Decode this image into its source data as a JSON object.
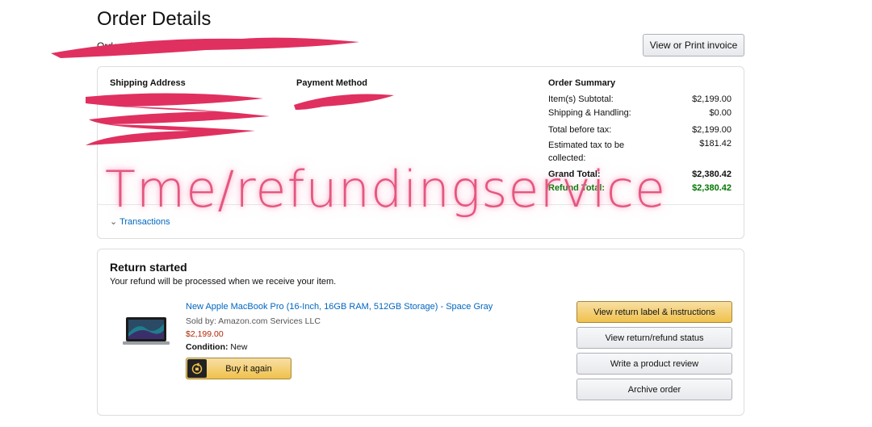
{
  "page": {
    "title": "Order Details",
    "ordered_line": "Ordered on",
    "invoice_button": "View or Print invoice"
  },
  "details": {
    "shipping_label": "Shipping Address",
    "payment_label": "Payment Method",
    "summary": {
      "heading": "Order Summary",
      "rows": [
        {
          "label": "Item(s) Subtotal:",
          "value": "$2,199.00"
        },
        {
          "label": "Shipping & Handling:",
          "value": "$0.00"
        },
        {
          "label": "Total before tax:",
          "value": "$2,199.00"
        },
        {
          "label": "Estimated tax to be collected:",
          "value": "$181.42"
        }
      ],
      "grand_total_label": "Grand Total:",
      "grand_total_value": "$2,380.42",
      "refund_total_label": "Refund Total:",
      "refund_total_value": "$2,380.42"
    },
    "transactions_link": "Transactions"
  },
  "return": {
    "title": "Return started",
    "subtitle": "Your refund will be processed when we receive your item.",
    "product": {
      "name": "New Apple MacBook Pro (16-Inch, 16GB RAM, 512GB Storage) - Space Gray",
      "sold_by": "Sold by: Amazon.com Services LLC",
      "price": "$2,199.00",
      "condition_label": "Condition:",
      "condition_value": "New",
      "buy_again": "Buy it again"
    },
    "actions": [
      "View return label & instructions",
      "View return/refund status",
      "Write a product review",
      "Archive order"
    ]
  },
  "overlay": {
    "watermark_text": "Tme/refundingservice",
    "watermark_color": "#e3587f",
    "redaction_color": "#e0305f"
  },
  "colors": {
    "link": "#0066c0",
    "price": "#b12704",
    "refund_green": "#007600",
    "primary_button": "#f0c14b"
  }
}
